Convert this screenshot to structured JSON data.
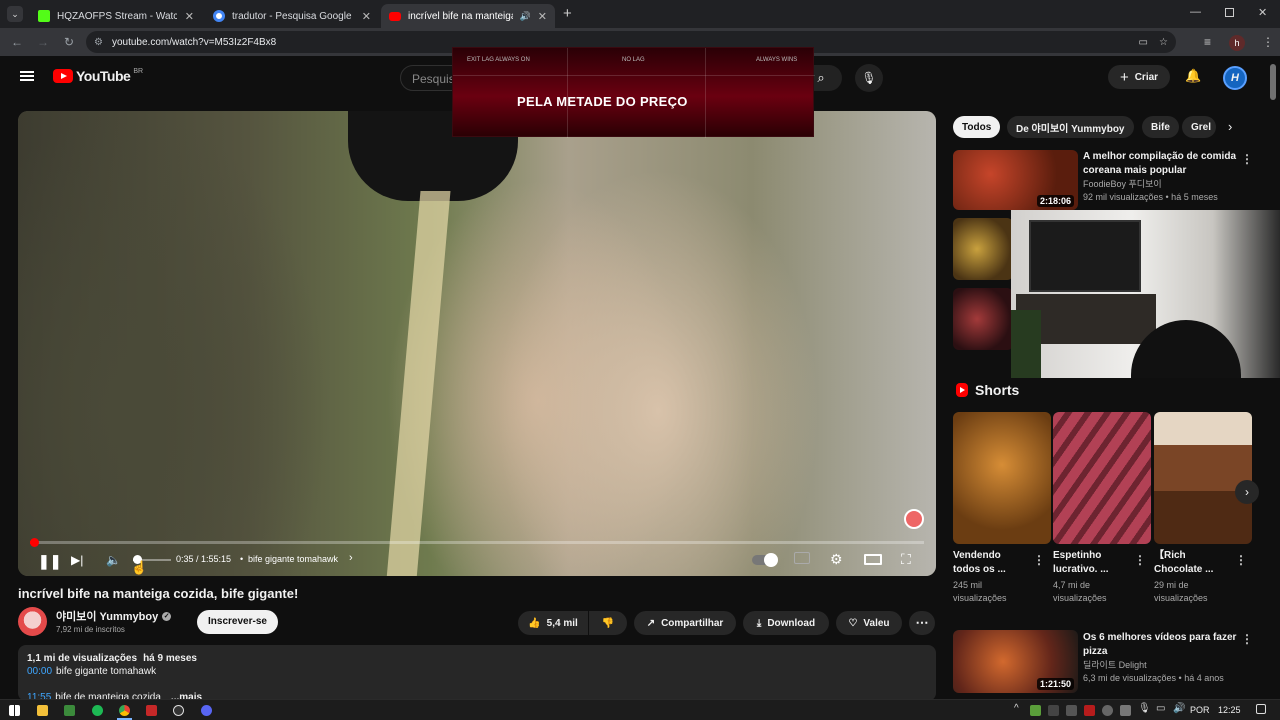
{
  "browser": {
    "tabs": [
      {
        "title": "HQZAOFPS Stream - Watch Live"
      },
      {
        "title": "tradutor - Pesquisa Google"
      },
      {
        "title": "incrível bife na manteiga co"
      }
    ],
    "url": "youtube.com/watch?v=M53Iz2F4Bx8",
    "profile_initial": "h"
  },
  "youtube": {
    "logo": "YouTube",
    "region": "BR",
    "search_placeholder": "Pesquis",
    "create_label": "Criar"
  },
  "overlay_ad": {
    "top_left": "EXIT LAG ALWAYS ON",
    "top_mid": "NO LAG",
    "top_right": "ALWAYS WINS",
    "headline": "PELA METADE DO PREÇO"
  },
  "player": {
    "time": "0:35 / 1:55:15",
    "chapter": "bife gigante tomahawk",
    "progress": 0.005,
    "volume": 0.1
  },
  "video": {
    "title": "incrível bife na manteiga cozida, bife gigante!",
    "channel": "야미보이 Yummyboy",
    "subscribers": "7,92 mi de inscritos",
    "subscribe_label": "Inscrever-se",
    "likes": "5,4 mil",
    "share_label": "Compartilhar",
    "download_label": "Download",
    "thanks_label": "Valeu",
    "description": {
      "stats_views": "1,1 mi de visualizações",
      "stats_age": "há 9 meses",
      "ts1": "00:00",
      "ts1_text": "bife gigante tomahawk",
      "ts2": "11:55",
      "ts2_text": "bife de manteiga cozida",
      "more": "...mais"
    }
  },
  "chips": [
    "Todos",
    "De 야미보이 Yummyboy",
    "Bife",
    "Grel"
  ],
  "recommended": [
    {
      "title_line1": "A melhor compilação de comida",
      "title_line2": "coreana mais popular",
      "channel": "FoodieBoy 푸디보이",
      "meta": "92 mil visualizações • há 5 meses",
      "duration": "2:18:06"
    },
    {
      "title_line1": "Os 6 melhores vídeos para fazer",
      "title_line2": "pizza",
      "channel": "딜라이트 Delight",
      "meta": "6,3 mi de visualizações • há 4 anos",
      "duration": "1:21:50"
    }
  ],
  "shorts": {
    "heading": "Shorts",
    "items": [
      {
        "line1": "Vendendo",
        "line2": "todos os ...",
        "views1": "245 mil",
        "views2": "visualizações"
      },
      {
        "line1": "Espetinho",
        "line2": "lucrativo. ...",
        "views1": "4,7 mi de",
        "views2": "visualizações"
      },
      {
        "line1": "【Rich",
        "line2": "Chocolate ...",
        "views1": "29 mi de",
        "views2": "visualizações"
      }
    ]
  },
  "taskbar": {
    "lang": "POR",
    "time": "12:25"
  },
  "colors": {
    "youtube_red": "#ff0000",
    "accent_blue": "#3ea6ff"
  }
}
